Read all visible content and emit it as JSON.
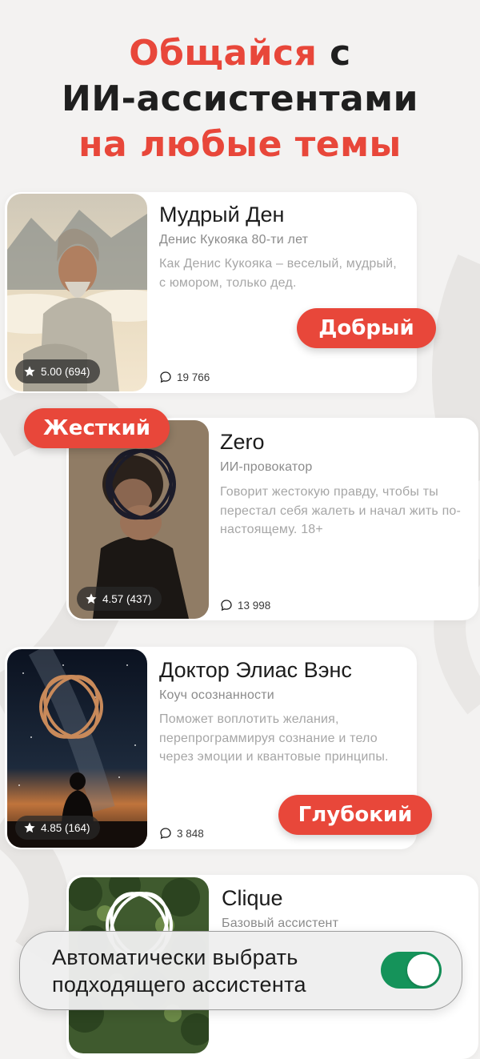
{
  "headline": {
    "part1_red": "Общайся",
    "part1_dark": " с",
    "line2": "ИИ-ассистентами",
    "line3": "на любые темы"
  },
  "colors": {
    "accent": "#e8473a",
    "toggle_on": "#15935a"
  },
  "assistants": [
    {
      "name": "Мудрый Ден",
      "subtitle": "Денис Кукояка 80-ти лет",
      "description": "Как Денис Кукояка – веселый, мудрый, с юмором, только дед.",
      "rating": "5.00 (694)",
      "chats": "19 766",
      "tag": "Добрый",
      "image": "old-man-portrait"
    },
    {
      "name": "Zero",
      "subtitle": "ИИ-провокатор",
      "description": "Говорит жестокую правду, чтобы ты перестал себя жалеть и начал жить по-настоящему. 18+",
      "rating": "4.57 (437)",
      "chats": "13 998",
      "tag": "Жесткий",
      "image": "fist-ring-portrait"
    },
    {
      "name": "Доктор Элиас Вэнс",
      "subtitle": "Коуч осознанности",
      "description": "Поможет воплотить желания, перепрограммируя сознание и тело через эмоции и квантовые принципы.",
      "rating": "4.85 (164)",
      "chats": "3 848",
      "tag": "Глубокий",
      "image": "milky-way-silhouette"
    },
    {
      "name": "Clique",
      "subtitle": "Базовый ассистент",
      "image": "forest-ring"
    }
  ],
  "auto_select": {
    "label_line1": "Автоматически выбрать",
    "label_line2": "подходящего ассистента",
    "enabled": true
  }
}
